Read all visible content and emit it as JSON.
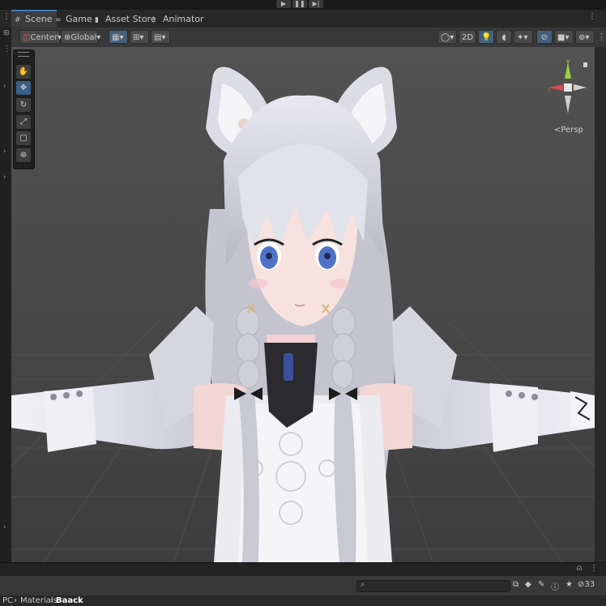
{
  "tabs": [
    {
      "label": "Scene",
      "icon": "scene-grid-icon",
      "active": true
    },
    {
      "label": "Game",
      "icon": "gamepad-icon",
      "active": false
    },
    {
      "label": "Asset Store",
      "icon": "shopping-bag-icon",
      "active": false
    },
    {
      "label": "Animator",
      "icon": "animator-icon",
      "active": false
    }
  ],
  "toolbar": {
    "pivot_label": "Center",
    "space_label": "Global",
    "view_2d_label": "2D"
  },
  "gizmo": {
    "projection_label": "<Persp",
    "axis_x": "x",
    "axis_y": "y"
  },
  "bottom_panel": {
    "search_placeholder": "",
    "hidden_count": "33"
  },
  "breadcrumb": [
    "PC",
    "Materials",
    "Baack"
  ],
  "colors": {
    "accent": "#3a79bb",
    "toggle_on": "#46607c",
    "axis_x": "#d64b4b",
    "axis_y": "#9bd244"
  }
}
